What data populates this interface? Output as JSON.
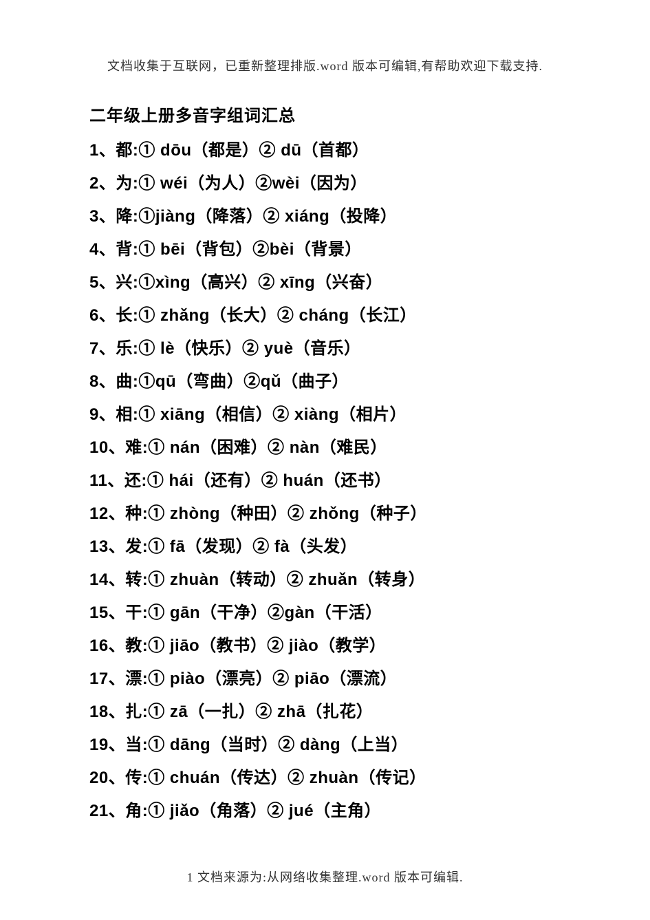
{
  "header_note": "文档收集于互联网，已重新整理排版.word 版本可编辑,有帮助欢迎下载支持.",
  "title": "二年级上册多音字组词汇总",
  "entries": [
    {
      "num": "1",
      "char": "都",
      "p1": "dōu",
      "w1": "都是",
      "p2": "dū",
      "w2": "首都",
      "sp1": "  ",
      "sp2": " "
    },
    {
      "num": "2",
      "char": "为",
      "p1": "wéi",
      "w1": "为人",
      "p2": "wèi",
      "w2": "因为",
      "sp1": "  ",
      "sp2": ""
    },
    {
      "num": "3",
      "char": "降",
      "p1": "jiàng",
      "w1": "降落",
      "p2": "xiáng",
      "w2": "投降",
      "sp1": "",
      "sp2": " "
    },
    {
      "num": "4",
      "char": "背",
      "p1": "bēi",
      "w1": "背包",
      "p2": "bèi",
      "w2": "背景",
      "sp1": "  ",
      "sp2": ""
    },
    {
      "num": "5",
      "char": "兴",
      "p1": "xìng",
      "w1": "高兴",
      "p2": "xīng",
      "w2": "兴奋",
      "sp1": "",
      "sp2": " "
    },
    {
      "num": "6",
      "char": "长",
      "p1": "zhǎng",
      "w1": "长大",
      "p2": "cháng",
      "w2": "长江",
      "sp1": "  ",
      "sp2": " "
    },
    {
      "num": "7",
      "char": "乐",
      "p1": "lè",
      "w1": "快乐",
      "p2": "yuè",
      "w2": "音乐",
      "sp1": "  ",
      "sp2": " "
    },
    {
      "num": "8",
      "char": "曲",
      "p1": "qū",
      "w1": "弯曲",
      "p2": "qǔ",
      "w2": "曲子",
      "sp1": "",
      "sp2": ""
    },
    {
      "num": "9",
      "char": "相",
      "p1": "xiāng",
      "w1": "相信",
      "p2": "xiàng",
      "w2": "相片",
      "sp1": "  ",
      "sp2": " "
    },
    {
      "num": "10",
      "char": "难",
      "p1": "nán",
      "w1": "困难",
      "p2": "nàn",
      "w2": "难民",
      "sp1": "  ",
      "sp2": " "
    },
    {
      "num": "11",
      "char": "还",
      "p1": "hái",
      "w1": "还有",
      "p2": "huán",
      "w2": "还书",
      "sp1": " ",
      "sp2": " "
    },
    {
      "num": "12",
      "char": "种",
      "p1": "zhòng",
      "w1": "种田",
      "p2": "zhǒng",
      "w2": "种子",
      "sp1": " ",
      "sp2": " "
    },
    {
      "num": "13",
      "char": "发",
      "p1": "fā",
      "w1": "发现",
      "p2": "fà",
      "w2": "头发",
      "sp1": "  ",
      "sp2": " "
    },
    {
      "num": "14",
      "char": "转",
      "p1": "zhuàn",
      "w1": "转动",
      "p2": "zhuǎn",
      "w2": "转身",
      "sp1": " ",
      "sp2": " "
    },
    {
      "num": "15",
      "char": "干",
      "p1": "gān",
      "w1": "干净",
      "p2": "gàn",
      "w2": "干活",
      "sp1": " ",
      "sp2": ""
    },
    {
      "num": "16",
      "char": "教",
      "p1": "jiāo",
      "w1": "教书",
      "p2": "jiào",
      "w2": "教学",
      "sp1": "  ",
      "sp2": " "
    },
    {
      "num": "17",
      "char": "漂",
      "p1": "piào",
      "w1": "漂亮",
      "p2": "piāo",
      "w2": "漂流",
      "sp1": "  ",
      "sp2": " "
    },
    {
      "num": "18",
      "char": "扎",
      "p1": "zā",
      "w1": "一扎",
      "p2": "zhā",
      "w2": "扎花",
      "sp1": "  ",
      "sp2": " "
    },
    {
      "num": "19",
      "char": "当",
      "p1": "dāng",
      "w1": "当时",
      "p2": "dàng",
      "w2": "上当",
      "sp1": "  ",
      "sp2": " "
    },
    {
      "num": "20",
      "char": "传",
      "p1": "chuán",
      "w1": "传达",
      "p2": "zhuàn",
      "w2": "传记",
      "sp1": "  ",
      "sp2": " "
    },
    {
      "num": "21",
      "char": "角",
      "p1": "jiǎo",
      "w1": "角落",
      "p2": "jué",
      "w2": "主角",
      "sp1": "  ",
      "sp2": " "
    }
  ],
  "footer_note": "1 文档来源为:从网络收集整理.word 版本可编辑."
}
